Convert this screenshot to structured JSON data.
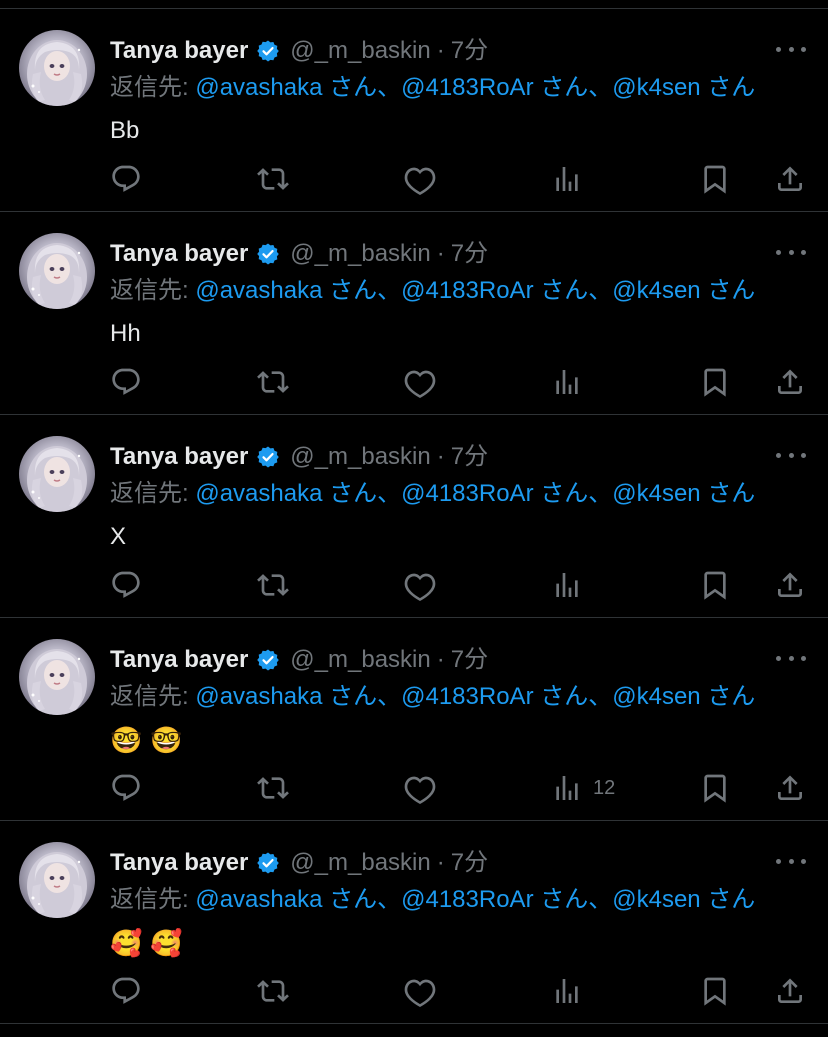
{
  "tweets": [
    {
      "author": "Tanya bayer",
      "handle": "@_m_baskin",
      "separator": "·",
      "time": "7分",
      "reply_prefix": "返信先:",
      "mentions": [
        "@avashaka",
        "@4183RoAr",
        "@k4sen"
      ],
      "mention_suffix": "さん",
      "mention_sep": "、",
      "body_text": "Bb",
      "body_emojis": [],
      "view_count": ""
    },
    {
      "author": "Tanya bayer",
      "handle": "@_m_baskin",
      "separator": "·",
      "time": "7分",
      "reply_prefix": "返信先:",
      "mentions": [
        "@avashaka",
        "@4183RoAr",
        "@k4sen"
      ],
      "mention_suffix": "さん",
      "mention_sep": "、",
      "body_text": "Hh",
      "body_emojis": [],
      "view_count": ""
    },
    {
      "author": "Tanya bayer",
      "handle": "@_m_baskin",
      "separator": "·",
      "time": "7分",
      "reply_prefix": "返信先:",
      "mentions": [
        "@avashaka",
        "@4183RoAr",
        "@k4sen"
      ],
      "mention_suffix": "さん",
      "mention_sep": "、",
      "body_text": "X",
      "body_emojis": [],
      "view_count": ""
    },
    {
      "author": "Tanya bayer",
      "handle": "@_m_baskin",
      "separator": "·",
      "time": "7分",
      "reply_prefix": "返信先:",
      "mentions": [
        "@avashaka",
        "@4183RoAr",
        "@k4sen"
      ],
      "mention_suffix": "さん",
      "mention_sep": "、",
      "body_text": "",
      "body_emojis": [
        "🤓",
        "🤓"
      ],
      "view_count": "12"
    },
    {
      "author": "Tanya bayer",
      "handle": "@_m_baskin",
      "separator": "·",
      "time": "7分",
      "reply_prefix": "返信先:",
      "mentions": [
        "@avashaka",
        "@4183RoAr",
        "@k4sen"
      ],
      "mention_suffix": "さん",
      "mention_sep": "、",
      "body_text": "",
      "body_emojis": [
        "🥰",
        "🥰"
      ],
      "view_count": ""
    }
  ],
  "colors": {
    "background": "#000000",
    "text": "#e7e9ea",
    "muted": "#71767b",
    "accent": "#1d9bf0",
    "divider": "#2f3336"
  },
  "icons": {
    "reply": "reply-icon",
    "retweet": "retweet-icon",
    "like": "heart-icon",
    "views": "views-icon",
    "bookmark": "bookmark-icon",
    "share": "share-icon",
    "more": "more-icon",
    "verified": "verified-badge-icon"
  }
}
